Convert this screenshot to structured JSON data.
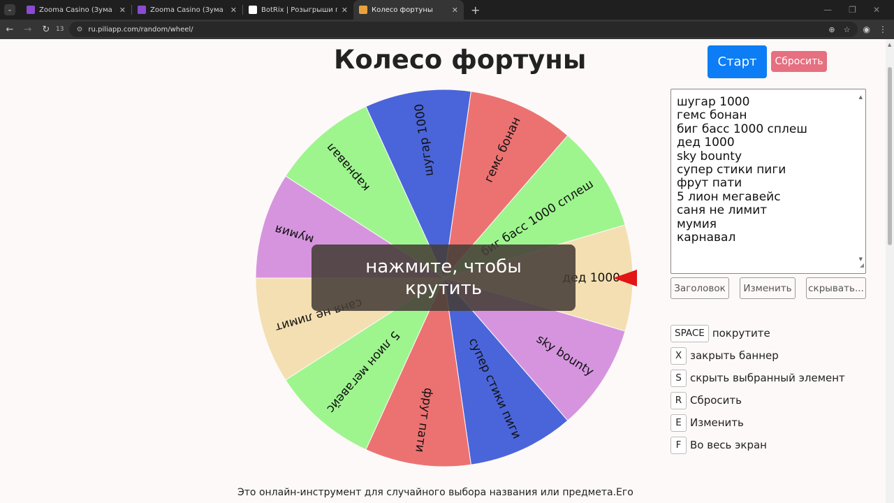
{
  "browser": {
    "tabs": [
      {
        "title": "Zooma Casino (Зума Казино) ©",
        "active": false,
        "icon_color": "#8a4bd1"
      },
      {
        "title": "Zooma Casino (Зума Казино) ©",
        "active": false,
        "icon_color": "#8a4bd1"
      },
      {
        "title": "BotRix | Розыгрыши призов",
        "active": false,
        "icon_color": "#ffffff"
      },
      {
        "title": "Колесо фортуны",
        "active": true,
        "icon_color": "#e9a23b"
      }
    ],
    "tab_count": "13",
    "url": "ru.piliapp.com/random/wheel/"
  },
  "page": {
    "title": "Колесо фортуны",
    "start_label": "Старт",
    "reset_label": "Сбросить",
    "overlay_text": "нажмите, чтобы крутить",
    "items": [
      "шугар 1000",
      "гемс бонан",
      "биг басс 1000 сплеш",
      "дед 1000",
      "sky bounty",
      "супер стики пиги",
      "фрут пати",
      "5 лион мегавейс",
      "саня не лимит",
      "мумия",
      "карнавал"
    ],
    "controls": {
      "title_label": "Заголовок",
      "change_label": "Изменить",
      "hide_label": "скрывать..."
    },
    "shortcuts": [
      {
        "key": "SPACE",
        "label": "покрутите"
      },
      {
        "key": "X",
        "label": "закрыть баннер"
      },
      {
        "key": "S",
        "label": "скрыть выбранный элемент"
      },
      {
        "key": "R",
        "label": "Сбросить"
      },
      {
        "key": "E",
        "label": "Изменить"
      },
      {
        "key": "F",
        "label": "Во весь экран"
      }
    ],
    "description": "Это онлайн-инструмент для случайного выбора названия или предмета.Его"
  },
  "wheel": {
    "segments": [
      {
        "label": "шугар 1000",
        "color": "#4a65d9"
      },
      {
        "label": "гемс бонан",
        "color": "#ec7272"
      },
      {
        "label": "биг басс 1000 сплеш",
        "color": "#9ef58e"
      },
      {
        "label": "дед 1000",
        "color": "#f4dfb2"
      },
      {
        "label": "sky bounty",
        "color": "#d694df"
      },
      {
        "label": "супер стики пиги",
        "color": "#4a65d9"
      },
      {
        "label": "фрут пати",
        "color": "#ec7272"
      },
      {
        "label": "5 лион мегавейс",
        "color": "#9ef58e"
      },
      {
        "label": "саня не лимит",
        "color": "#f4dfb2"
      },
      {
        "label": "мумия",
        "color": "#d694df"
      },
      {
        "label": "карнавал",
        "color": "#9ef58e"
      }
    ],
    "pointer_color": "#e21414"
  }
}
